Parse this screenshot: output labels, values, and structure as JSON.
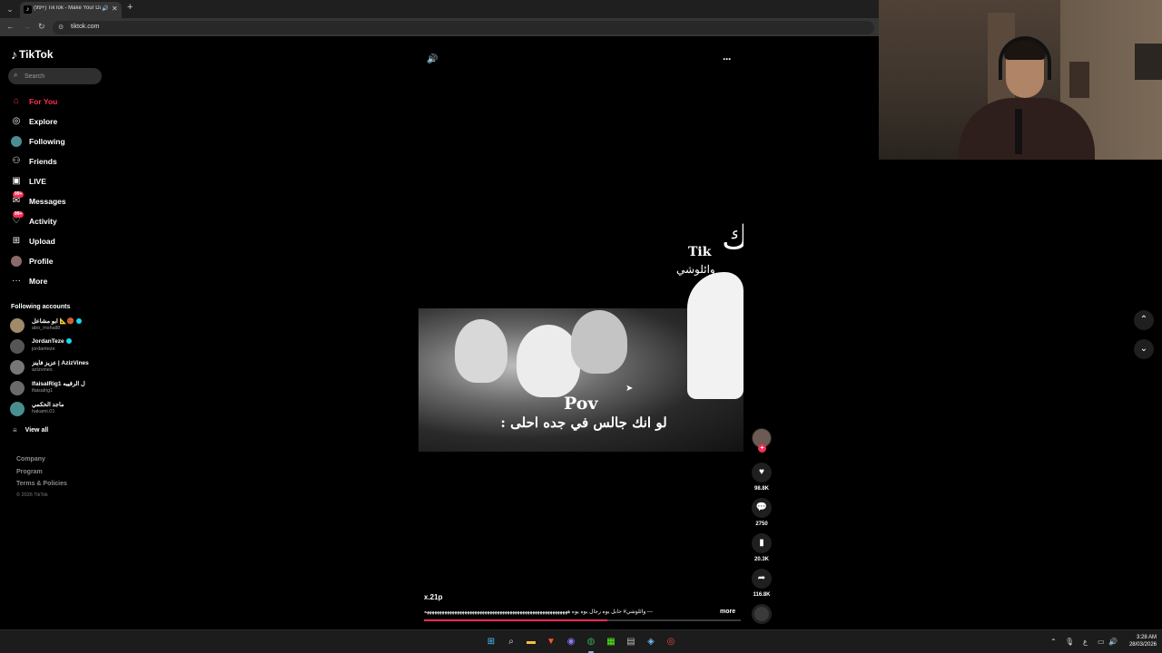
{
  "browser": {
    "tab_title": "(99+) TikTok - Make Your Day",
    "url": "tiktok.com"
  },
  "sidebar": {
    "logo_text": "TikTok",
    "search_placeholder": "Search",
    "nav": [
      {
        "label": "For You",
        "icon": "home-icon",
        "active": true
      },
      {
        "label": "Explore",
        "icon": "compass-icon"
      },
      {
        "label": "Following",
        "icon": "following-avatar-icon"
      },
      {
        "label": "Friends",
        "icon": "friends-icon"
      },
      {
        "label": "LIVE",
        "icon": "live-icon"
      },
      {
        "label": "Messages",
        "icon": "messages-icon",
        "badge": "99+"
      },
      {
        "label": "Activity",
        "icon": "activity-icon",
        "badge": "99+"
      },
      {
        "label": "Upload",
        "icon": "upload-icon"
      },
      {
        "label": "Profile",
        "icon": "profile-avatar-icon"
      },
      {
        "label": "More",
        "icon": "more-dots-icon"
      }
    ],
    "following_title": "Following accounts",
    "accounts": [
      {
        "name": "ابو مشاعل 📐🏀",
        "handle": "abo_mshall8",
        "verified": true
      },
      {
        "name": "JordanTeze",
        "handle": "jordanteze",
        "verified": true
      },
      {
        "name": "عزيز فاينز | AzizVines",
        "handle": "azizvines",
        "verified": false
      },
      {
        "name": "lfaisalRig1 ل الرقيبه",
        "handle": "lfaisalrig1",
        "verified": false
      },
      {
        "name": "ماجد الحكمي",
        "handle": "hakami.01",
        "verified": false
      }
    ],
    "view_all": "View all",
    "footer_links": [
      "Company",
      "Program",
      "Terms & Policies"
    ],
    "copyright": "© 2026 TikTok"
  },
  "video": {
    "watermark_tik": "Tik",
    "watermark_arabic": "وائلوشي",
    "overlay_title": "Pov",
    "overlay_caption": "لو انك جالس في جده احلى :",
    "author": "x.21p",
    "description": "--- وائلوشي# حابل يوه رجال يوه يوه هههههههههههههههههههههههههههههههههههههههههههههههههههههههههه",
    "more": "more",
    "progress_percent": 58
  },
  "actions": {
    "likes": "98.8K",
    "comments": "2750",
    "saves": "20.3K",
    "shares": "116.8K"
  },
  "taskbar": {
    "time": "3:28 AM",
    "date": "28/03/2026",
    "lang": "ع"
  },
  "colors": {
    "accent": "#fe2c55",
    "verified": "#20d5ec",
    "background": "#000000"
  }
}
